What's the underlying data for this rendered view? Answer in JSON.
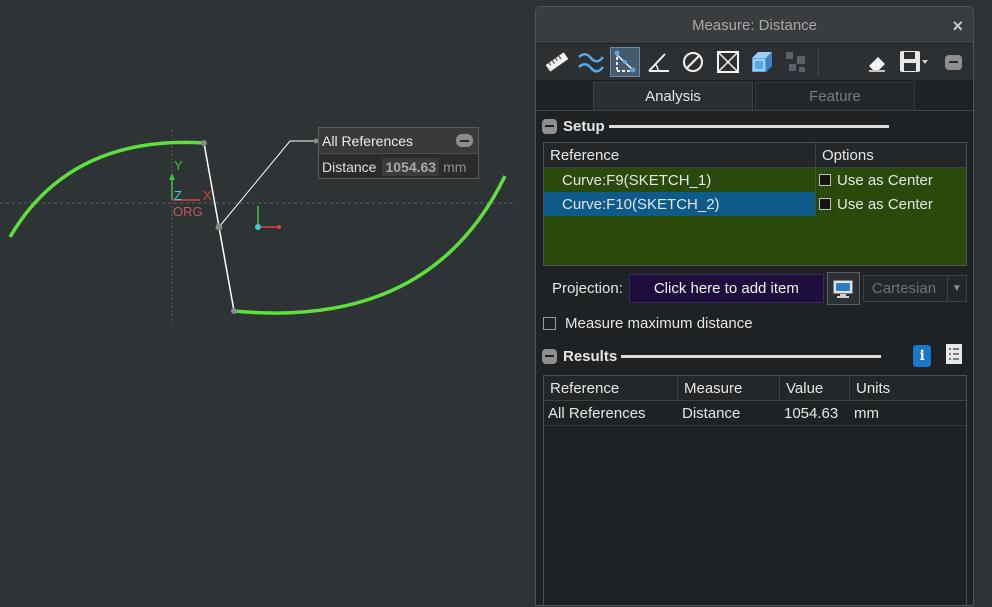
{
  "viewport": {
    "callout": {
      "title": "All References",
      "label": "Distance",
      "value": "1054.63",
      "unit": "mm"
    },
    "triad": {
      "y_label": "Y",
      "z_label": "Z",
      "x_label": "X",
      "origin_label": "ORG"
    }
  },
  "panel": {
    "title": "Measure: Distance",
    "close_glyph": "×",
    "toolbar": {
      "icons": [
        "ruler-icon",
        "curve-icon",
        "distance-icon",
        "angle-icon",
        "diameter-icon",
        "transform-icon",
        "volume-icon",
        "compare-icon",
        "eraser-icon",
        "save-icon",
        "minimize-icon"
      ],
      "active_icon": "distance-icon"
    },
    "tabs": {
      "analysis": "Analysis",
      "feature": "Feature"
    },
    "setup": {
      "title": "Setup",
      "columns": {
        "reference": "Reference",
        "options": "Options"
      },
      "rows": [
        {
          "reference": "Curve:F9(SKETCH_1)",
          "option": "Use as Center"
        },
        {
          "reference": "Curve:F10(SKETCH_2)",
          "option": "Use as Center"
        }
      ],
      "projection_label": "Projection:",
      "projection_placeholder": "Click here to add item",
      "coord_system": "Cartesian",
      "max_distance_label": "Measure maximum distance"
    },
    "results": {
      "title": "Results",
      "columns": {
        "reference": "Reference",
        "measure": "Measure",
        "value": "Value",
        "units": "Units"
      },
      "rows": [
        {
          "reference": "All References",
          "measure": "Distance",
          "value": "1054.63",
          "units": "mm"
        }
      ]
    }
  },
  "colors": {
    "curve": "#5fe03a",
    "row_green": "#2a4a0c",
    "row_selected": "#0e5a8a",
    "projection_box": "#1e0e3e"
  }
}
